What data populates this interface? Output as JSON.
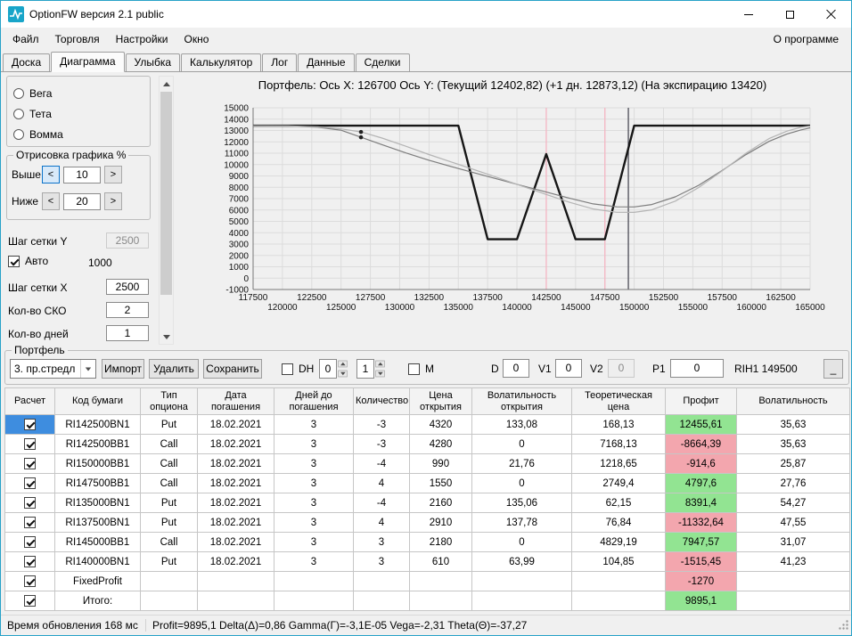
{
  "window": {
    "title": "OptionFW версия 2.1 public"
  },
  "menu": {
    "items": [
      "Файл",
      "Торговля",
      "Настройки",
      "Окно"
    ],
    "right": "О программе"
  },
  "tabs": [
    {
      "label": "Доска",
      "active": false
    },
    {
      "label": "Диаграмма",
      "active": true
    },
    {
      "label": "Улыбка",
      "active": false
    },
    {
      "label": "Калькулятор",
      "active": false
    },
    {
      "label": "Лог",
      "active": false
    },
    {
      "label": "Данные",
      "active": false
    },
    {
      "label": "Сделки",
      "active": false
    }
  ],
  "left_panel": {
    "radios": [
      {
        "label": "Вега",
        "selected": false
      },
      {
        "label": "Тета",
        "selected": false
      },
      {
        "label": "Вомма",
        "selected": false
      }
    ],
    "draw_group": {
      "title": "Отрисовка графика %",
      "above_label": "Выше",
      "above_value": "10",
      "below_label": "Ниже",
      "below_value": "20",
      "dec_glyph": "<",
      "inc_glyph": ">"
    },
    "grid_y_label": "Шаг сетки Y",
    "grid_y_value": "2500",
    "auto_label": "Авто",
    "auto_checked": true,
    "auto_extra": "1000",
    "grid_x_label": "Шаг сетки X",
    "grid_x_value": "2500",
    "sko_label": "Кол-во СКО",
    "sko_value": "2",
    "days_label": "Кол-во дней",
    "days_value": "1"
  },
  "chart": {
    "title": "Портфель: Ось X: 126700 Ось Y:  (Текущий 12402,82)  (+1 дн. 12873,12)  (На экспирацию 13420)",
    "chart_data": {
      "type": "line",
      "x_range": [
        117500,
        165000
      ],
      "y_range": [
        -1000,
        15000
      ],
      "x_step": 2500,
      "y_step": 1000,
      "x_ticks": [
        117500,
        120000,
        122500,
        125000,
        127500,
        130000,
        132500,
        135000,
        137500,
        140000,
        142500,
        145000,
        147500,
        150000,
        152500,
        155000,
        157500,
        160000,
        162500,
        165000
      ],
      "y_ticks": [
        15000,
        14000,
        13000,
        12000,
        11000,
        10000,
        9000,
        8000,
        7000,
        6000,
        5000,
        4000,
        3000,
        2000,
        1000,
        0,
        -1000
      ],
      "grid": true,
      "vlines": [
        {
          "name": "strike-marker-1",
          "x": 142500,
          "color": "#f5b6c3"
        },
        {
          "name": "strike-marker-2",
          "x": 147500,
          "color": "#f5b6c3"
        },
        {
          "name": "current-price-line",
          "x": 149500,
          "color": "#4c4c57"
        }
      ],
      "markers": [
        {
          "name": "current-value-dot",
          "x": 126700,
          "y": 12402.82
        },
        {
          "name": "plus1day-value-dot",
          "x": 126700,
          "y": 12873.12
        }
      ],
      "series": [
        {
          "name": "expiration-payoff",
          "color": "#161616",
          "width": 2.4,
          "points": [
            [
              117500,
              13420
            ],
            [
              135000,
              13420
            ],
            [
              137500,
              3420
            ],
            [
              140000,
              3420
            ],
            [
              142500,
              10920
            ],
            [
              145000,
              3420
            ],
            [
              147500,
              3420
            ],
            [
              150000,
              13420
            ],
            [
              165000,
              13420
            ]
          ]
        },
        {
          "name": "current-value",
          "color": "#7d7d7d",
          "width": 1.2,
          "points": [
            [
              117500,
              13405
            ],
            [
              120500,
              13390
            ],
            [
              123000,
              13290
            ],
            [
              125000,
              13020
            ],
            [
              126700,
              12403
            ],
            [
              128500,
              11750
            ],
            [
              130500,
              11030
            ],
            [
              132500,
              10380
            ],
            [
              135000,
              9650
            ],
            [
              137500,
              8950
            ],
            [
              140000,
              8260
            ],
            [
              142500,
              7580
            ],
            [
              144500,
              7030
            ],
            [
              146500,
              6540
            ],
            [
              148500,
              6280
            ],
            [
              150000,
              6270
            ],
            [
              151500,
              6480
            ],
            [
              153500,
              7160
            ],
            [
              155500,
              8180
            ],
            [
              157500,
              9480
            ],
            [
              159500,
              10860
            ],
            [
              161500,
              12040
            ],
            [
              163000,
              12680
            ],
            [
              164200,
              13050
            ],
            [
              165000,
              13230
            ]
          ]
        },
        {
          "name": "plus-1-day-value",
          "color": "#b4b4b4",
          "width": 1.2,
          "points": [
            [
              117500,
              13412
            ],
            [
              120500,
              13400
            ],
            [
              123000,
              13330
            ],
            [
              125000,
              13140
            ],
            [
              126700,
              12873
            ],
            [
              128500,
              12330
            ],
            [
              130500,
              11620
            ],
            [
              132500,
              10880
            ],
            [
              135000,
              10020
            ],
            [
              137500,
              9150
            ],
            [
              140000,
              8260
            ],
            [
              142500,
              7370
            ],
            [
              144500,
              6670
            ],
            [
              146500,
              6090
            ],
            [
              148500,
              5800
            ],
            [
              150000,
              5790
            ],
            [
              151500,
              6010
            ],
            [
              153500,
              6780
            ],
            [
              155500,
              7980
            ],
            [
              157500,
              9440
            ],
            [
              159500,
              10980
            ],
            [
              161500,
              12290
            ],
            [
              163000,
              12940
            ],
            [
              164200,
              13280
            ],
            [
              165000,
              13390
            ]
          ]
        }
      ]
    }
  },
  "portfolio_bar": {
    "group_label": "Портфель",
    "preset": "3. пр.стредл",
    "btn_import": "Импорт",
    "btn_delete": "Удалить",
    "btn_save": "Сохранить",
    "dh_label": "DH",
    "dh_checked": false,
    "dh_spin1": "0",
    "dh_spin2": "1",
    "m_label": "M",
    "m_checked": false,
    "d_label": "D",
    "d_value": "0",
    "v1_label": "V1",
    "v1_value": "0",
    "v2_label": "V2",
    "v2_value": "0",
    "p1_label": "P1",
    "p1_value": "0",
    "ticker": "RIH1 149500",
    "min_button_label": "_"
  },
  "table": {
    "columns": [
      "Расчет",
      "Код бумаги",
      "Тип опциона",
      "Дата погашения",
      "Дней до погашения",
      "Количество",
      "Цена открытия",
      "Волатильность открытия",
      "Теоретическая цена",
      "Профит",
      "Волатильность"
    ],
    "rows": [
      {
        "checked": true,
        "selected": true,
        "code": "RI142500BN1",
        "type": "Put",
        "date": "18.02.2021",
        "days": "3",
        "qty": "-3",
        "open": "4320",
        "open_vol": "133,08",
        "theo": "168,13",
        "profit": "12455,61",
        "profit_color": "green",
        "vol": "35,63"
      },
      {
        "checked": true,
        "code": "RI142500BB1",
        "type": "Call",
        "date": "18.02.2021",
        "days": "3",
        "qty": "-3",
        "open": "4280",
        "open_vol": "0",
        "theo": "7168,13",
        "profit": "-8664,39",
        "profit_color": "red",
        "vol": "35,63"
      },
      {
        "checked": true,
        "code": "RI150000BB1",
        "type": "Call",
        "date": "18.02.2021",
        "days": "3",
        "qty": "-4",
        "open": "990",
        "open_vol": "21,76",
        "theo": "1218,65",
        "profit": "-914,6",
        "profit_color": "red",
        "vol": "25,87"
      },
      {
        "checked": true,
        "code": "RI147500BB1",
        "type": "Call",
        "date": "18.02.2021",
        "days": "3",
        "qty": "4",
        "open": "1550",
        "open_vol": "0",
        "theo": "2749,4",
        "profit": "4797,6",
        "profit_color": "green",
        "vol": "27,76"
      },
      {
        "checked": true,
        "code": "RI135000BN1",
        "type": "Put",
        "date": "18.02.2021",
        "days": "3",
        "qty": "-4",
        "open": "2160",
        "open_vol": "135,06",
        "theo": "62,15",
        "profit": "8391,4",
        "profit_color": "green",
        "vol": "54,27"
      },
      {
        "checked": true,
        "code": "RI137500BN1",
        "type": "Put",
        "date": "18.02.2021",
        "days": "3",
        "qty": "4",
        "open": "2910",
        "open_vol": "137,78",
        "theo": "76,84",
        "profit": "-11332,64",
        "profit_color": "red",
        "vol": "47,55"
      },
      {
        "checked": true,
        "code": "RI145000BB1",
        "type": "Call",
        "date": "18.02.2021",
        "days": "3",
        "qty": "3",
        "open": "2180",
        "open_vol": "0",
        "theo": "4829,19",
        "profit": "7947,57",
        "profit_color": "green",
        "vol": "31,07"
      },
      {
        "checked": true,
        "code": "RI140000BN1",
        "type": "Put",
        "date": "18.02.2021",
        "days": "3",
        "qty": "3",
        "open": "610",
        "open_vol": "63,99",
        "theo": "104,85",
        "profit": "-1515,45",
        "profit_color": "red",
        "vol": "41,23"
      },
      {
        "checked": true,
        "code": "FixedProfit",
        "profit": "-1270",
        "profit_color": "red"
      },
      {
        "checked": true,
        "code": "Итого:",
        "profit": "9895,1",
        "profit_color": "green"
      }
    ]
  },
  "status_bar": {
    "left": "Время обновления 168 мс",
    "metrics": "Profit=9895,1 Delta(Δ)=0,86 Gamma(Γ)=-3,1E-05 Vega=-2,31 Theta(Θ)=-37,27"
  }
}
